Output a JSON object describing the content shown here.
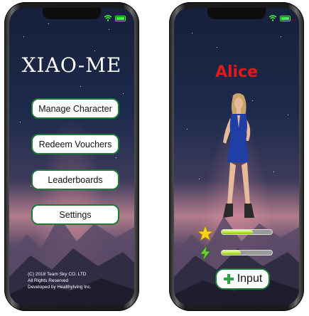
{
  "menu_screen": {
    "title": "XIAO-ME",
    "buttons": [
      {
        "label": "Manage Character"
      },
      {
        "label": "Redeem Vouchers"
      },
      {
        "label": "Leaderboards"
      },
      {
        "label": "Settings"
      }
    ],
    "footer": {
      "line1": "(C) 2018 Team Sky CO. LTD",
      "line2": "All Rights Reserved",
      "line3": "Developed by HealthyIving Inc."
    }
  },
  "character_screen": {
    "name": "Alice",
    "stats": [
      {
        "icon": "star-icon",
        "level": 0.62
      },
      {
        "icon": "lightning-icon",
        "level": 0.38
      }
    ],
    "input_button": {
      "label": "Input",
      "icon": "plus-icon"
    }
  },
  "status_bar": {
    "wifi": "wifi-icon",
    "battery": "battery-icon"
  },
  "colors": {
    "button_border": "#1d7a39",
    "character_name": "#e01a1a",
    "battery": "#3aff3a",
    "bar_fill": "#b6e43c"
  }
}
